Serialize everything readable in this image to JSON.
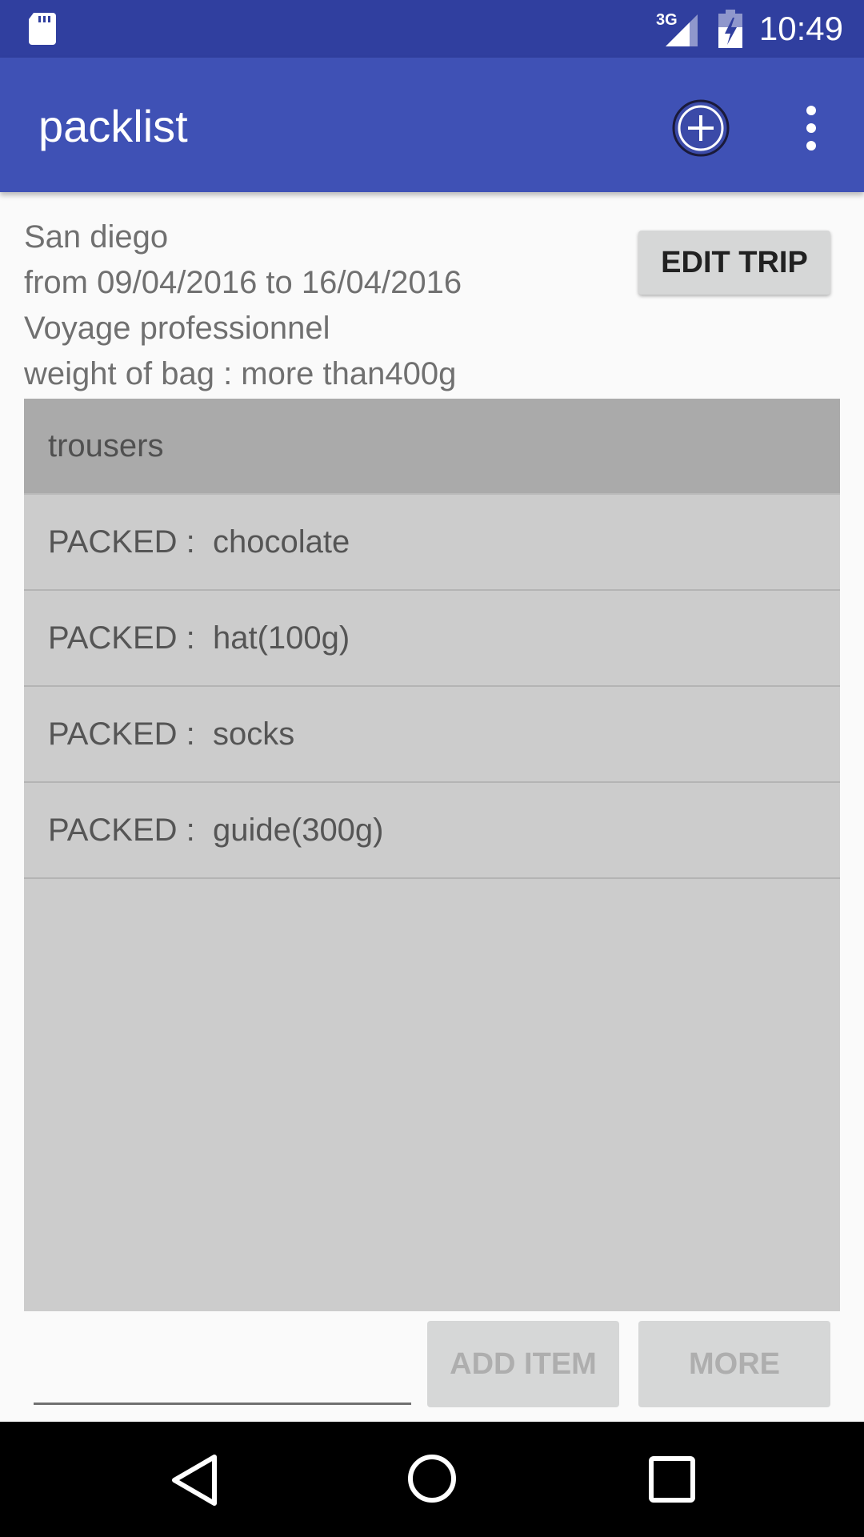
{
  "status_bar": {
    "network_label": "3G",
    "time": "10:49",
    "icons": [
      "sd-card-icon",
      "signal-icon",
      "battery-charging-icon"
    ]
  },
  "app_bar": {
    "title": "packlist",
    "actions": [
      "add-circle-icon",
      "overflow-menu-icon"
    ]
  },
  "trip": {
    "destination": "San diego",
    "dates": "from 09/04/2016 to 16/04/2016",
    "type": "Voyage professionnel",
    "weight": "weight of bag : more than400g",
    "edit_button": "EDIT TRIP"
  },
  "list": {
    "header": "trousers",
    "items": [
      {
        "status": "PACKED :",
        "name": "chocolate"
      },
      {
        "status": "PACKED :",
        "name": "hat(100g)"
      },
      {
        "status": "PACKED :",
        "name": "socks"
      },
      {
        "status": "PACKED :",
        "name": "guide(300g)"
      }
    ]
  },
  "bottom": {
    "input_value": "",
    "add_item_button": "ADD ITEM",
    "more_button": "MORE"
  },
  "colors": {
    "status_bar": "#303f9f",
    "app_bar": "#3f51b5",
    "list_bg": "#cccccc",
    "header_bg": "#aaaaaa"
  }
}
